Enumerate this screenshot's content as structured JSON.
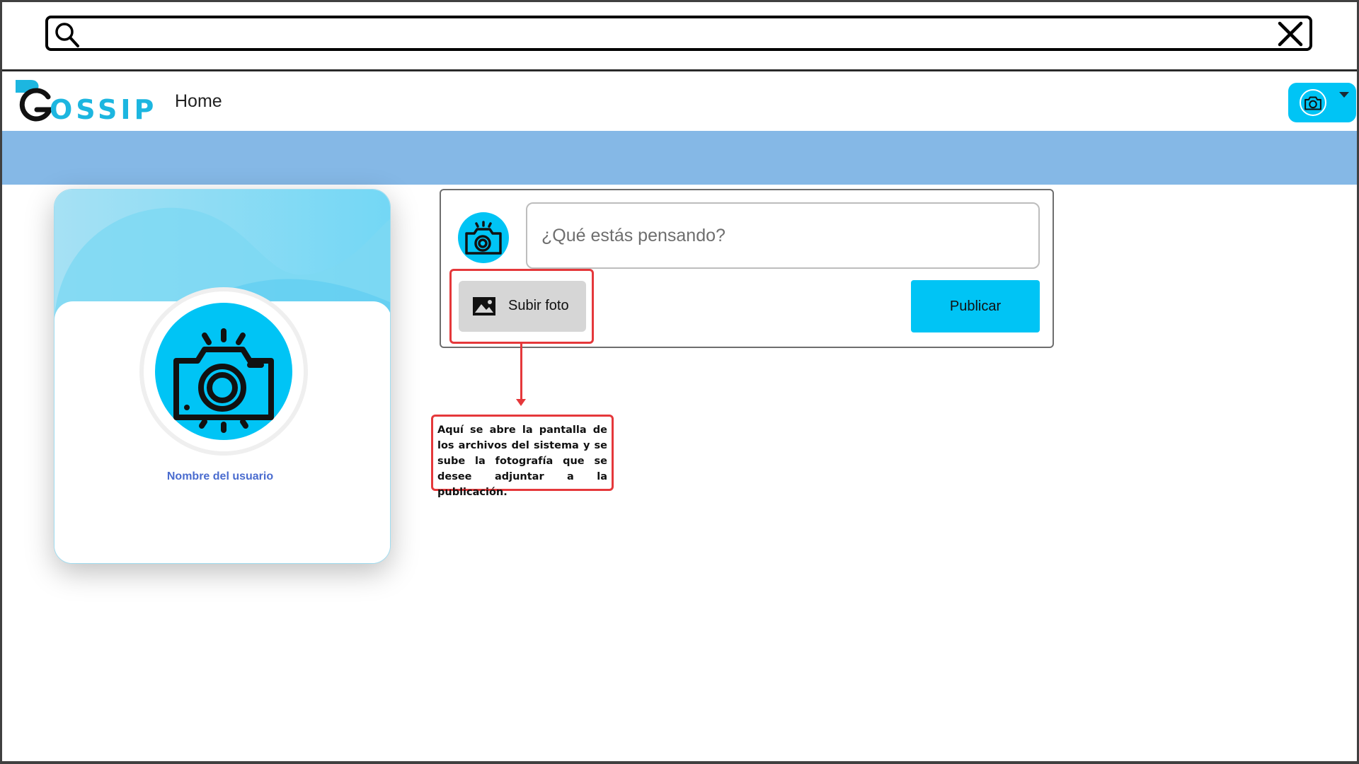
{
  "search": {
    "value": "",
    "placeholder": ""
  },
  "navbar": {
    "logo_text": "OSSIP",
    "home_label": "Home"
  },
  "profile": {
    "name": "Nombre del usuario"
  },
  "composer": {
    "placeholder": "¿Qué estás pensando?",
    "upload_label": "Subir foto",
    "publish_label": "Publicar"
  },
  "annotation": {
    "text": "Aquí se abre la pantalla de los archivos del sistema y se sube la fotografía que se desee adjuntar a la publicación."
  },
  "icons": {
    "search": "search-icon",
    "close": "close-icon",
    "camera": "camera-icon",
    "image": "image-icon",
    "caret": "chevron-down-icon"
  },
  "colors": {
    "accent": "#00c4f5",
    "banner": "#85b8e6",
    "annotation": "#e5383b",
    "username": "#4a6ccf",
    "logo": "#1cb6e0"
  }
}
